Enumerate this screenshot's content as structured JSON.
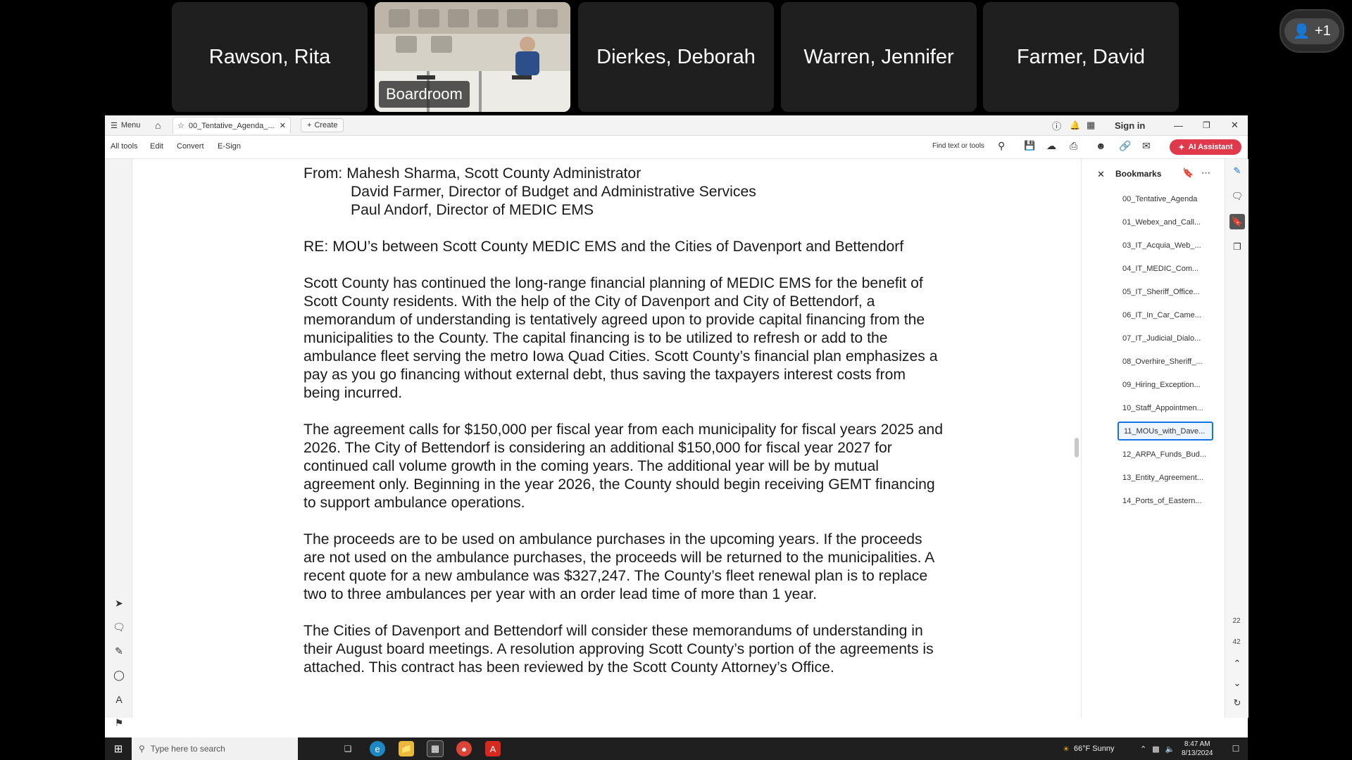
{
  "meeting": {
    "participants": [
      "Rawson, Rita",
      "Dierkes, Deborah",
      "Warren, Jennifer",
      "Farmer, David"
    ],
    "video_label": "Boardroom",
    "overflow_count": "+1"
  },
  "titlebar": {
    "menu_label": "Menu",
    "tab_label": "00_Tentative_Agenda_...",
    "create_label": "Create",
    "sign_in_label": "Sign in"
  },
  "toolbar": {
    "items": [
      "All tools",
      "Edit",
      "Convert",
      "E-Sign"
    ],
    "find_placeholder": "Find text or tools",
    "ai_assistant_label": "AI Assistant"
  },
  "document": {
    "from_line": "From: Mahesh Sharma, Scott County Administrator",
    "from_extra": [
      "David Farmer, Director of Budget and Administrative Services",
      "Paul Andorf, Director of MEDIC EMS"
    ],
    "re_line": "RE: MOU’s between Scott County MEDIC EMS and the Cities of Davenport and Bettendorf",
    "paragraphs": [
      [
        "Scott County has continued the long-range financial planning of MEDIC EMS for the benefit of",
        "Scott County residents.  With the help of the City of Davenport and City of Bettendorf, a",
        "memorandum of understanding is tentatively agreed upon to provide capital financing from the",
        "municipalities to the County.  The capital financing is to be utilized to refresh or add to the",
        "ambulance fleet serving the metro Iowa Quad Cities.  Scott County’s financial plan emphasizes a",
        "pay as you go financing without external debt, thus saving the taxpayers interest costs from",
        "being incurred."
      ],
      [
        "The agreement calls for $150,000 per fiscal year from each municipality for fiscal years 2025 and",
        "2026.  The City of Bettendorf is considering an additional $150,000 for fiscal year 2027 for",
        "continued call volume growth in the coming years.  The additional year will be by mutual",
        "agreement only.  Beginning in the year 2026, the County should begin receiving GEMT financing",
        "to support ambulance operations."
      ],
      [
        "The proceeds are to be used on ambulance purchases in the upcoming years.  If the proceeds",
        "are not used on the ambulance purchases, the proceeds will be returned to the municipalities.  A",
        "recent quote for a new ambulance was $327,247. The County’s fleet renewal plan is to replace",
        "two to three ambulances per year with an order lead time of more than 1 year."
      ],
      [
        "The Cities of Davenport and Bettendorf will consider these memorandums of understanding in",
        "their August board meetings.   A resolution approving Scott County’s portion of the agreements is",
        "attached.   This contract has been reviewed by the Scott County Attorney’s Office."
      ]
    ]
  },
  "bookmarks": {
    "title": "Bookmarks",
    "items": [
      "00_Tentative_Agenda",
      "01_Webex_and_Call...",
      "03_IT_Acquia_Web_...",
      "04_IT_MEDIC_Com...",
      "05_IT_Sheriff_Office...",
      "06_IT_In_Car_Came...",
      "07_IT_Judicial_Dialo...",
      "08_Overhire_Sheriff_...",
      "09_Hiring_Exception...",
      "10_Staff_Appointmen...",
      "11_MOUs_with_Dave...",
      "12_ARPA_Funds_Bud...",
      "13_Entity_Agreement...",
      "14_Ports_of_Eastern..."
    ],
    "active_index": 10
  },
  "page_nav": {
    "current_page": "22",
    "total_pages": "42"
  },
  "taskbar": {
    "search_placeholder": "Type here to search",
    "weather": "66°F  Sunny",
    "time": "8:47 AM",
    "date": "8/13/2024"
  },
  "colors": {
    "accent": "#1473e6",
    "ai_button": "#e0394b",
    "tile_bg": "#1f1f1f"
  }
}
